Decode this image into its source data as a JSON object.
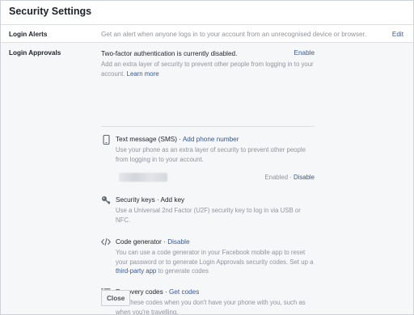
{
  "header": {
    "title": "Security Settings"
  },
  "login_alerts": {
    "label": "Login Alerts",
    "description": "Get an alert when anyone logs in to your account from an unrecognised device or browser.",
    "edit_label": "Edit"
  },
  "login_approvals": {
    "label": "Login Approvals",
    "status": "Two-factor authentication is currently disabled.",
    "enable_label": "Enable",
    "intro": "Add an extra layer of security to prevent other people from logging in to your account.",
    "learn_more": "Learn more",
    "methods": {
      "sms": {
        "title": "Text message (SMS)",
        "separator": " · ",
        "action": "Add phone number",
        "description": "Use your phone as an extra layer of security to prevent other people from logging in to your account.",
        "enabled_label": "Enabled",
        "status_sep": " · ",
        "disable_label": "Disable",
        "icon": "phone-icon"
      },
      "security_keys": {
        "title": "Security keys",
        "separator": " · ",
        "action": "Add key",
        "description": "Use a Universal 2nd Factor (U2F) security key to log in via USB or NFC.",
        "icon": "key-icon"
      },
      "code_generator": {
        "title": "Code generator",
        "separator": " · ",
        "action": "Disable",
        "description_pre": "You can use a code generator in your Facebook mobile app to reset your password or to generate Login Approvals security codes. Set up a ",
        "third_party_link": "third-party app",
        "description_post": " to generate codes",
        "icon": "code-icon"
      },
      "recovery_codes": {
        "title": "Recovery codes",
        "separator": " · ",
        "action": "Get codes",
        "description": "Use these codes when you don't have your phone with you, such as when you're travelling.",
        "icon": "list-icon"
      }
    },
    "close_label": "Close"
  }
}
